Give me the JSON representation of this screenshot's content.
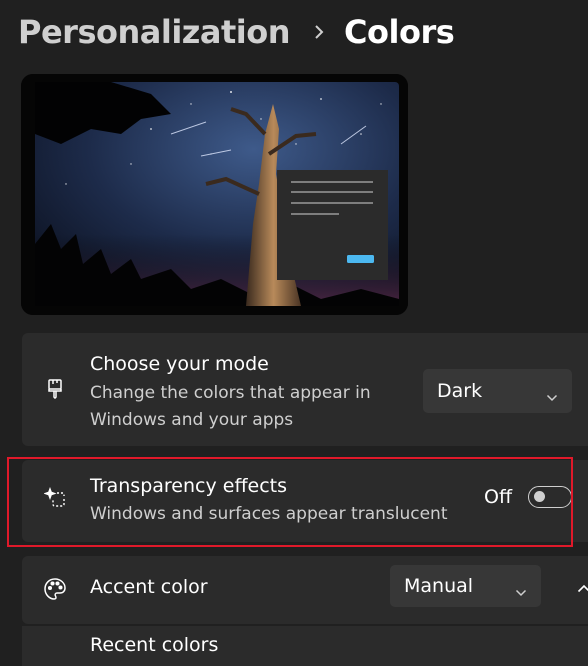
{
  "breadcrumb": {
    "parent": "Personalization",
    "current": "Colors"
  },
  "icons": {
    "chevron_right": "chevron-right-icon",
    "brush": "paintbrush-icon",
    "sparkle": "transparency-icon",
    "palette": "palette-icon",
    "chevron_down": "chevron-down-icon",
    "chevron_up": "chevron-up-icon"
  },
  "mode": {
    "title": "Choose your mode",
    "description": "Change the colors that appear in Windows and your apps",
    "selected": "Dark"
  },
  "transparency": {
    "title": "Transparency effects",
    "description": "Windows and surfaces appear translucent",
    "state_label": "Off",
    "enabled": false
  },
  "accent": {
    "title": "Accent color",
    "selected": "Manual",
    "expanded": true
  },
  "recent": {
    "title": "Recent colors"
  },
  "colors": {
    "background": "#202020",
    "card": "#2b2b2b",
    "dropdown": "#373737",
    "highlight": "#e0192a",
    "preview_accent": "#4cb8f0"
  }
}
